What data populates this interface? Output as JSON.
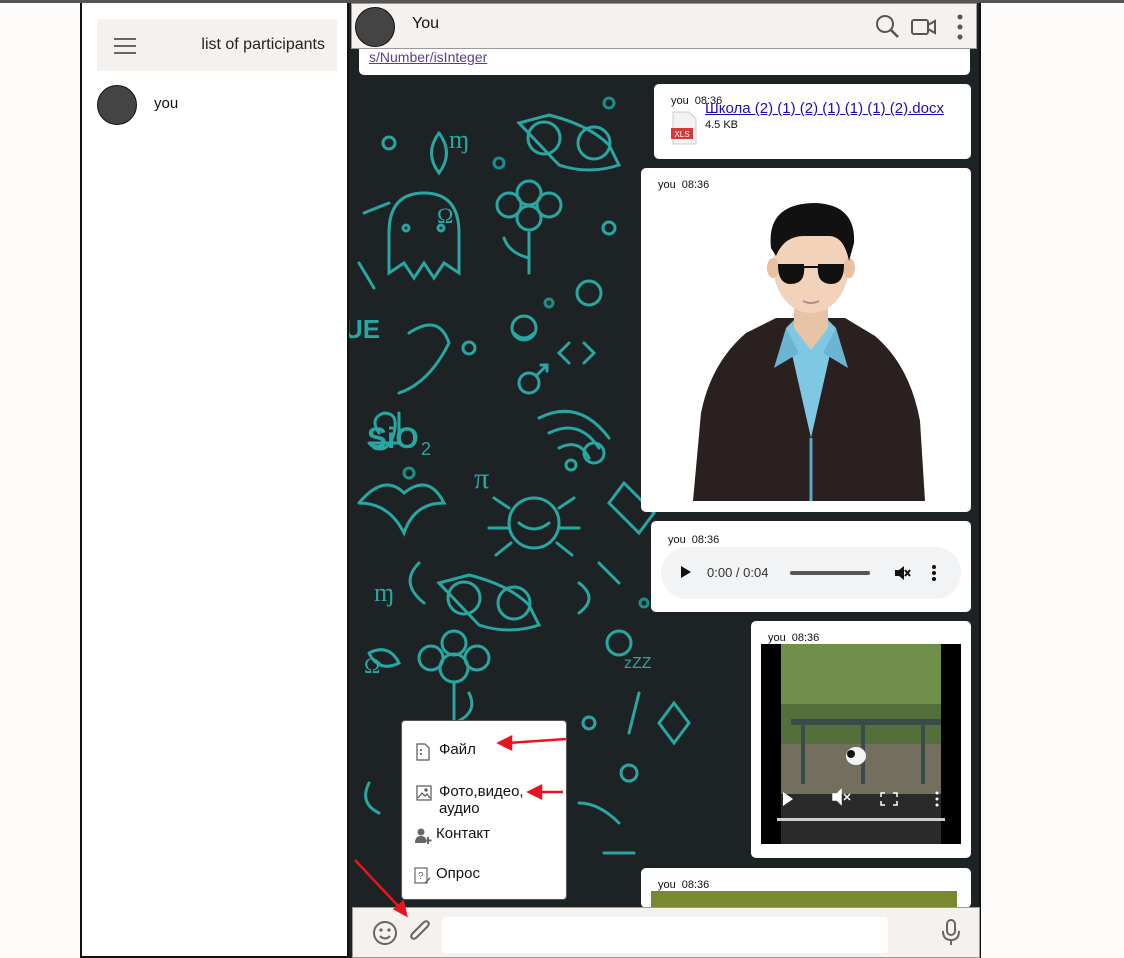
{
  "sidebar": {
    "title": "list of participants",
    "participants": [
      {
        "name": "you"
      }
    ]
  },
  "chat": {
    "title": "You",
    "top_link": "s/Number/isInteger"
  },
  "messages": {
    "file": {
      "sender": "you",
      "time": "08:36",
      "file_name": "Школа (2) (1) (2) (1) (1) (1) (2).docx",
      "file_badge": "XLS",
      "file_size": "4.5 KB"
    },
    "image": {
      "sender": "you",
      "time": "08:36"
    },
    "audio": {
      "sender": "you",
      "time": "08:36",
      "time_display": "0:00 / 0:04"
    },
    "video": {
      "sender": "you",
      "time": "08:36"
    },
    "last": {
      "sender": "you",
      "time": "08:36"
    }
  },
  "attach_menu": {
    "items": [
      {
        "label": "Файл",
        "icon": "file-icon"
      },
      {
        "label": "Фото,видео,\nаудио",
        "icon": "image-icon"
      },
      {
        "label": "Контакт",
        "icon": "contact-add-icon"
      },
      {
        "label": "Опрос",
        "icon": "poll-icon"
      }
    ]
  },
  "input": {
    "value": "",
    "placeholder": ""
  },
  "colors": {
    "wallpaper_bg": "#1d2324",
    "wallpaper_doodle": "#2bb5b0",
    "annotation_arrow": "#e8141e",
    "header_bg": "#f4f1ee"
  }
}
